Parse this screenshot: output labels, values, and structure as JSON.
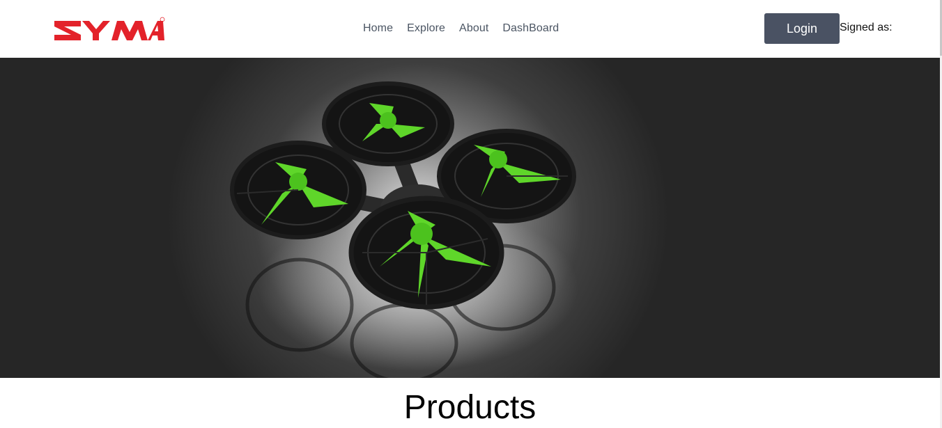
{
  "brand": {
    "name": "SYMA",
    "color": "#e3222a"
  },
  "nav": {
    "items": [
      {
        "label": "Home"
      },
      {
        "label": "Explore"
      },
      {
        "label": "About"
      },
      {
        "label": "DashBoard"
      }
    ]
  },
  "header": {
    "login_label": "Login",
    "signed_label": "Signed as:"
  },
  "hero": {
    "image": "quadcopter-drone-green-propellers"
  },
  "products": {
    "title": "Products"
  },
  "colors": {
    "accent": "#4a5263",
    "propeller": "#5fd62a"
  }
}
